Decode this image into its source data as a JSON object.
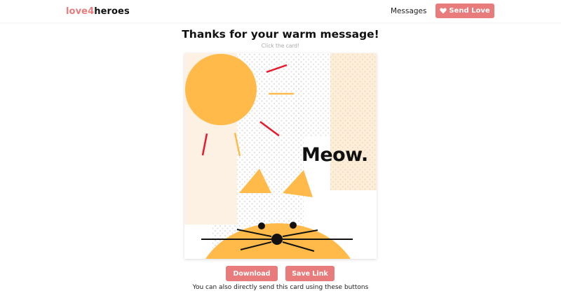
{
  "nav": {
    "brand_part1": "love4",
    "brand_part2": "heroes",
    "messages_link": "Messages",
    "send_love_label": "Send Love",
    "heart_icon": "heart-icon"
  },
  "main": {
    "title": "Thanks for your warm message!",
    "hint": "Click the card!"
  },
  "card": {
    "text": "Meow.",
    "colors": {
      "sun": "#ffba4a",
      "cat": "#ffba4a",
      "rays_red": "#e8192c",
      "rays_orange": "#ffba4a",
      "panel_peach": "#fdeed9",
      "dots": "#d9d9d9"
    }
  },
  "actions": {
    "download_label": "Download",
    "save_link_label": "Save Link",
    "note": "You can also directly send this card using these buttons"
  },
  "colors": {
    "accent": "#e87b7b"
  }
}
